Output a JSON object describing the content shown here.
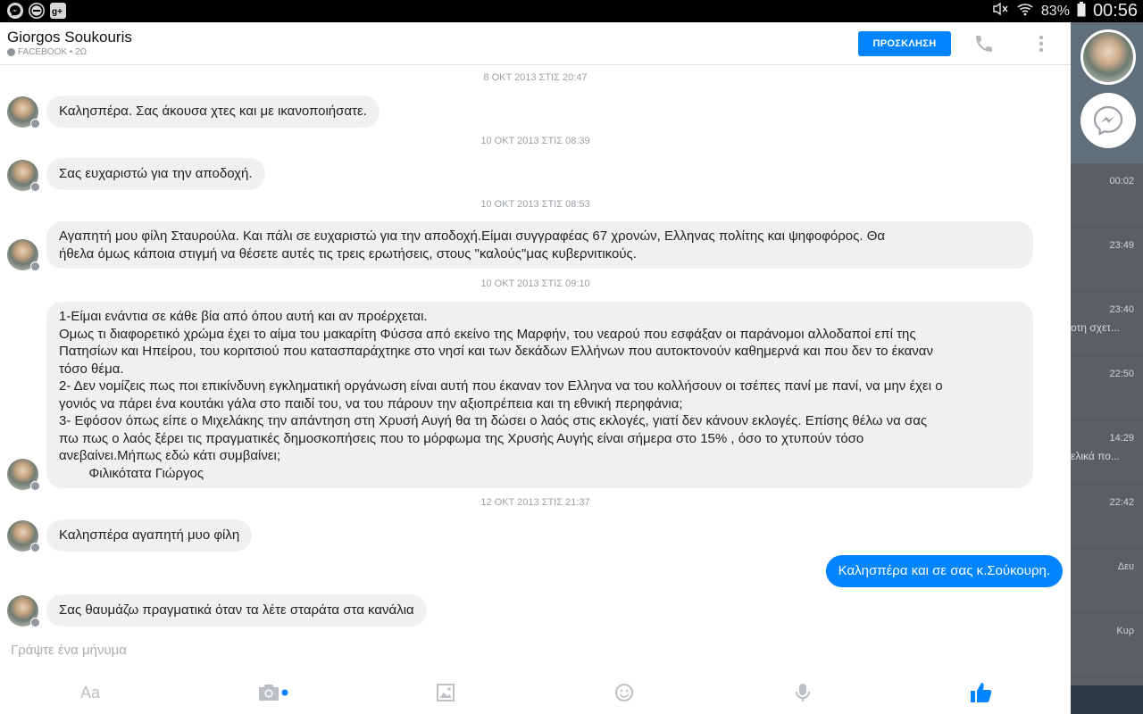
{
  "status_bar": {
    "battery": "83%",
    "time": "00:56"
  },
  "header": {
    "contact_name": "Giorgos Soukouris",
    "subtitle": "FACEBOOK • 2Ω",
    "invite_label": "ΠΡΟΣΚΛΗΣΗ"
  },
  "messages": [
    {
      "timestamp": "8 ΟΚΤ 2013 ΣΤΙΣ 20:47",
      "text": "Καλησπέρα. Σας άκουσα χτες και με ικανοποιήσατε."
    },
    {
      "timestamp": "10 ΟΚΤ 2013 ΣΤΙΣ 08:39",
      "text": "Σας ευχαριστώ για την αποδοχή."
    },
    {
      "timestamp": "10 ΟΚΤ 2013 ΣΤΙΣ 08:53",
      "lines": [
        "Αγαπητή μου φίλη Σταυρούλα. Και πάλι σε ευχαριστώ για την αποδοχή.Είμαι συγγραφέας 67 χρονών, Ελληνας πολίτης και ψηφοφόρος. Θα",
        "ήθελα όμως κάποια στιγμή να θέσετε αυτές τις τρεις ερωτήσεις, στους \"καλούς\"μας κυβερνιτικούς."
      ]
    },
    {
      "timestamp": "10 ΟΚΤ 2013 ΣΤΙΣ 09:10",
      "lines": [
        "1-Είμαι ενάντια σε κάθε βία από όπου αυτή και αν προέρχεται.",
        "Ομως τι διαφορετικό χρώμα έχει το αίμα του μακαρίτη Φύσσα από εκείνο της Μαρφήν, του νεαρού που εσφάξαν οι παράνομοι αλλοδαποί επί της",
        "Πατησίων και Ηπείρου, του κοριτσιού που κατασπαράχτηκε στο νησί και των δεκάδων Ελλήνων που αυτοκτονούν καθημερνά και που δεν το έκαναν",
        "τόσο θέμα.",
        "2- Δεν νομίζεις πως ποι επικίνδυνη εγκληματική οργάνωση είναι αυτή που έκαναν τον Ελληνα να του κολλήσουν οι τσέπες πανί με πανί, να μην έχει ο",
        "γονιός να πάρει ένα κουτάκι γάλα στο παιδί του, να του πάρουν την αξιοπρέπεια και τη εθνική περηφάνια;",
        "3- Εφόσον όπως είπε ο Μιχελάκης την απάντηση στη Χρυσή Αυγή θα τη δώσει ο λαός στις εκλογές, γιατί δεν κάνουν εκλογές. Επίσης θέλω να σας",
        "πω πως ο λαός ξέρει τις πραγματικές δημοσκοπήσεις που το μόρφωμα της Χρυσής Αυγής είναι σήμερα στο 15% , όσο το χτυπούν τόσο",
        "ανεβαίνει.Μήπως εδώ κάτι συμβαίνει;",
        "        Φιλικότατα Γιώργος"
      ]
    },
    {
      "timestamp": "12 ΟΚΤ 2013 ΣΤΙΣ 21:37",
      "text": "Καλησπέρα αγαπητή μυο φίλη"
    },
    {
      "text": "Καλησπέρα και σε σας κ.Σούκουρη.",
      "mine": true
    },
    {
      "text": "Σας θαυμάζω πραγματικά όταν τα λέτε σταράτα στα κανάλια"
    }
  ],
  "composer": {
    "placeholder": "Γράψτε ένα μήνυμα",
    "text_tool": "Aa"
  },
  "background_list": [
    {
      "time": "00:02",
      "snippet": ""
    },
    {
      "time": "23:49",
      "snippet": ""
    },
    {
      "time": "23:40",
      "snippet": "οτη σχετ..."
    },
    {
      "time": "22:50",
      "snippet": ""
    },
    {
      "time": "14:29",
      "snippet": "ελικά πο..."
    },
    {
      "time": "22:42",
      "snippet": ""
    },
    {
      "time": "Δευ",
      "snippet": ""
    },
    {
      "time": "Κυρ",
      "snippet": ""
    }
  ],
  "colors": {
    "accent": "#0084ff",
    "bubble_incoming": "#f1f0f0",
    "muted_text": "#9aa0a6"
  },
  "icons": [
    "messenger-icon",
    "minus-circle-icon",
    "google-plus-icon",
    "phone-icon",
    "more-vertical-icon",
    "camera-icon",
    "image-icon",
    "emoji-icon",
    "microphone-icon",
    "thumbs-up-icon"
  ]
}
